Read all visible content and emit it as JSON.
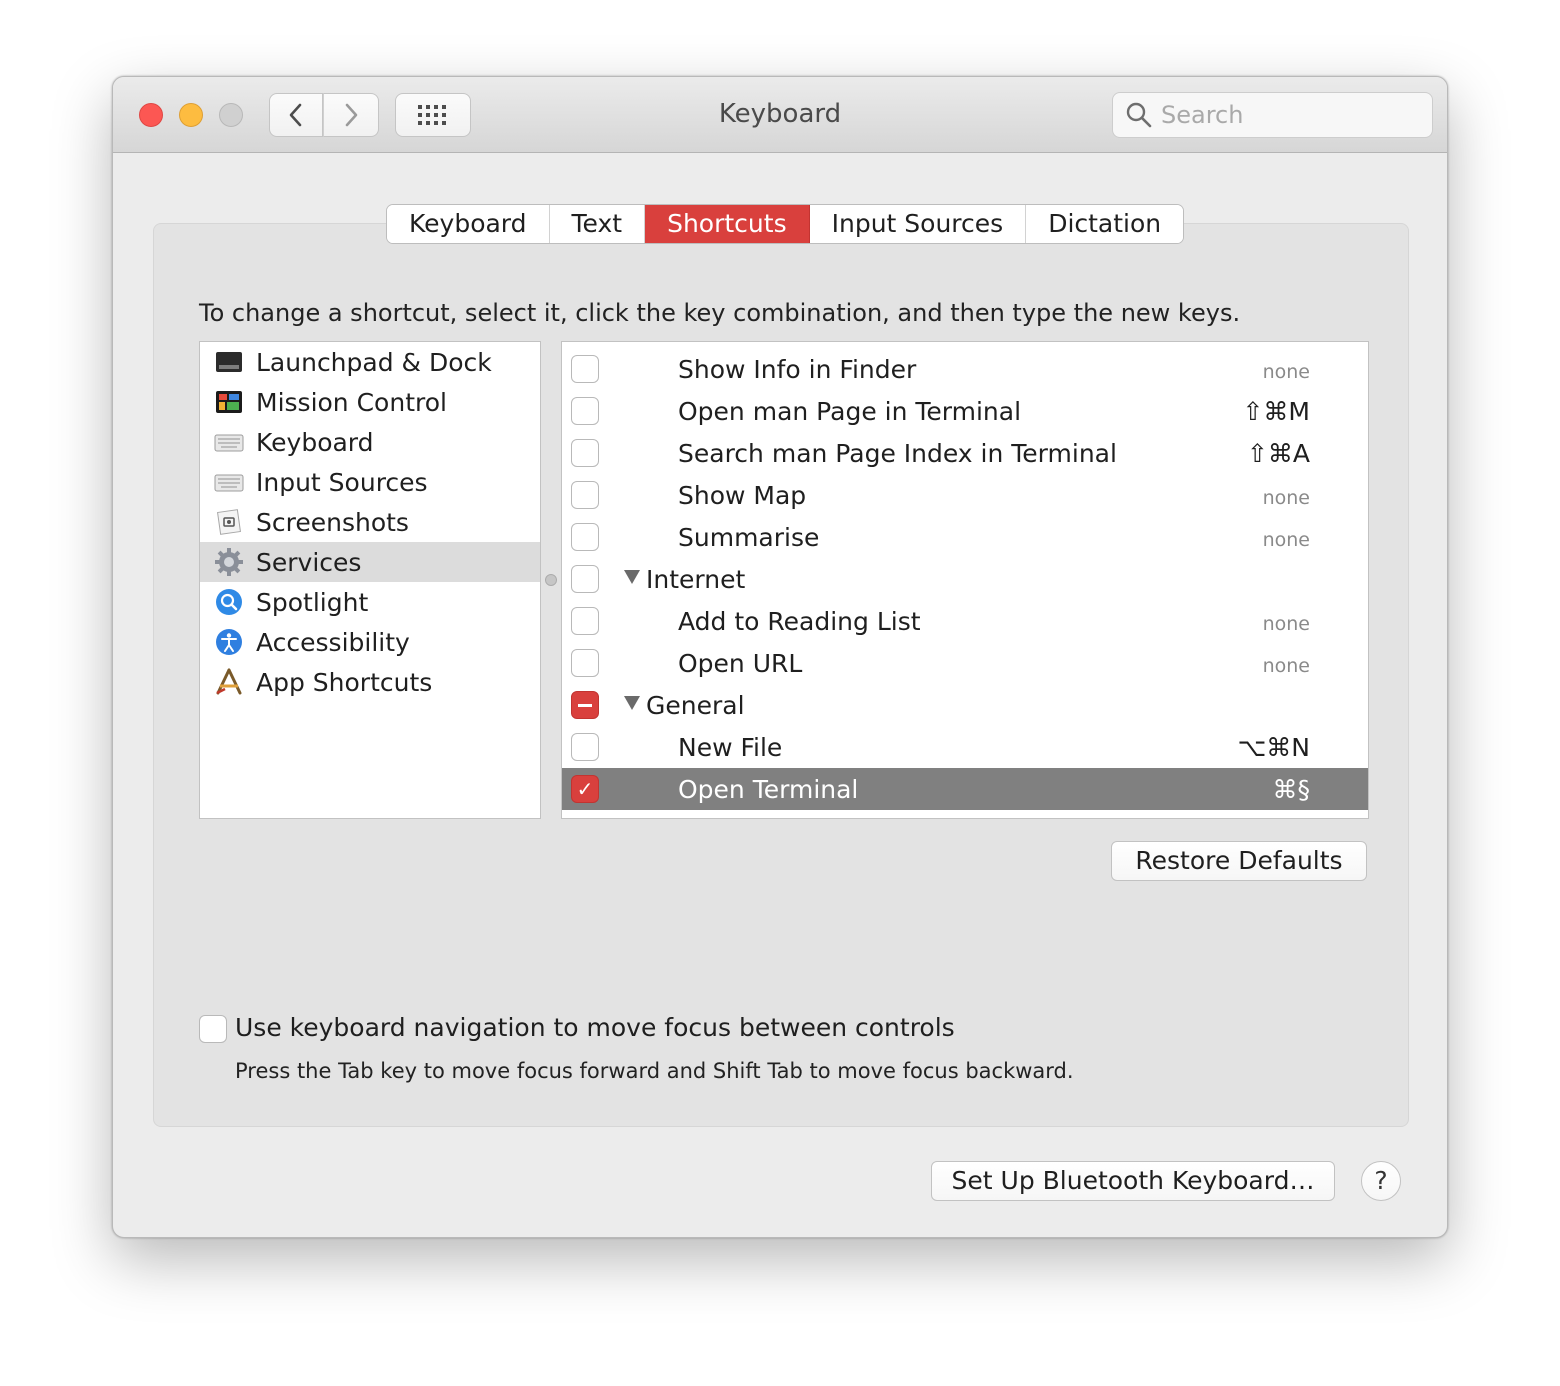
{
  "window": {
    "title": "Keyboard"
  },
  "search": {
    "placeholder": "Search"
  },
  "tabs": [
    {
      "label": "Keyboard"
    },
    {
      "label": "Text"
    },
    {
      "label": "Shortcuts",
      "active": true
    },
    {
      "label": "Input Sources"
    },
    {
      "label": "Dictation"
    }
  ],
  "hint": "To change a shortcut, select it, click the key combination, and then type the new keys.",
  "categories": [
    {
      "label": "Launchpad & Dock",
      "icon": "launchpad-dock-icon"
    },
    {
      "label": "Mission Control",
      "icon": "mission-control-icon"
    },
    {
      "label": "Keyboard",
      "icon": "keyboard-icon"
    },
    {
      "label": "Input Sources",
      "icon": "input-sources-icon"
    },
    {
      "label": "Screenshots",
      "icon": "screenshots-icon"
    },
    {
      "label": "Services",
      "icon": "gear-icon",
      "selected": true
    },
    {
      "label": "Spotlight",
      "icon": "spotlight-icon"
    },
    {
      "label": "Accessibility",
      "icon": "accessibility-icon"
    },
    {
      "label": "App Shortcuts",
      "icon": "app-shortcuts-icon"
    }
  ],
  "shortcuts": [
    {
      "name": "Show Info in Finder",
      "keys": "none",
      "state": "unchecked"
    },
    {
      "name": "Open man Page in Terminal",
      "keys": "⇧⌘M",
      "state": "unchecked"
    },
    {
      "name": "Search man Page Index in Terminal",
      "keys": "⇧⌘A",
      "state": "unchecked"
    },
    {
      "name": "Show Map",
      "keys": "none",
      "state": "unchecked"
    },
    {
      "name": "Summarise",
      "keys": "none",
      "state": "unchecked"
    },
    {
      "name": "Internet",
      "group": true,
      "state": "unchecked"
    },
    {
      "name": "Add to Reading List",
      "keys": "none",
      "state": "unchecked"
    },
    {
      "name": "Open URL",
      "keys": "none",
      "state": "unchecked"
    },
    {
      "name": "General",
      "group": true,
      "state": "mixed"
    },
    {
      "name": "New File",
      "keys": "⌥⌘N",
      "state": "unchecked"
    },
    {
      "name": "Open Terminal",
      "keys": "⌘§",
      "state": "checked",
      "selected": true
    }
  ],
  "buttons": {
    "restore_defaults": "Restore Defaults",
    "bluetooth": "Set Up Bluetooth Keyboard…",
    "help": "?"
  },
  "keyboard_nav": {
    "label": "Use keyboard navigation to move focus between controls",
    "description": "Press the Tab key to move focus forward and Shift Tab to move focus backward."
  },
  "colors": {
    "accent": "#d9403d",
    "selection": "#808080"
  }
}
